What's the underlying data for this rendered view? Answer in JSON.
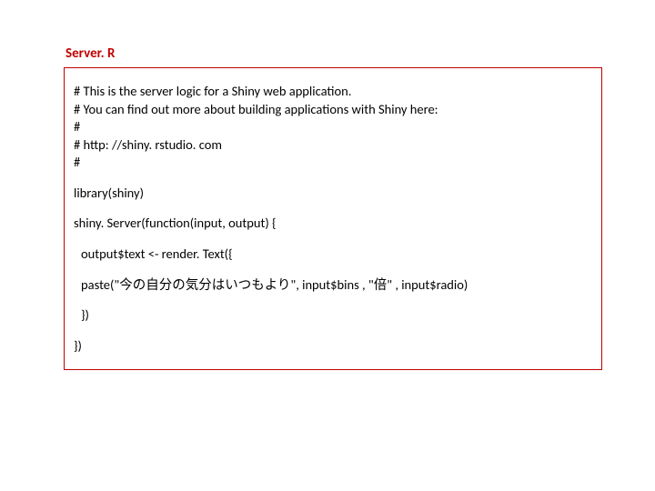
{
  "title": "Server. R",
  "code": {
    "comments": [
      "# This is the server logic for a Shiny web application.",
      "# You can find out more about building applications with Shiny here:",
      "#",
      "# http: //shiny. rstudio. com",
      "#"
    ],
    "library_line": "library(shiny)",
    "server_open": "shiny. Server(function(input, output) {",
    "output_assign": "output$text <- render. Text({",
    "paste_line": "paste(\"今の自分の気分はいつもより\", input$bins , \"倍\" , input$radio)",
    "close_inner": "})",
    "close_outer": "})"
  }
}
